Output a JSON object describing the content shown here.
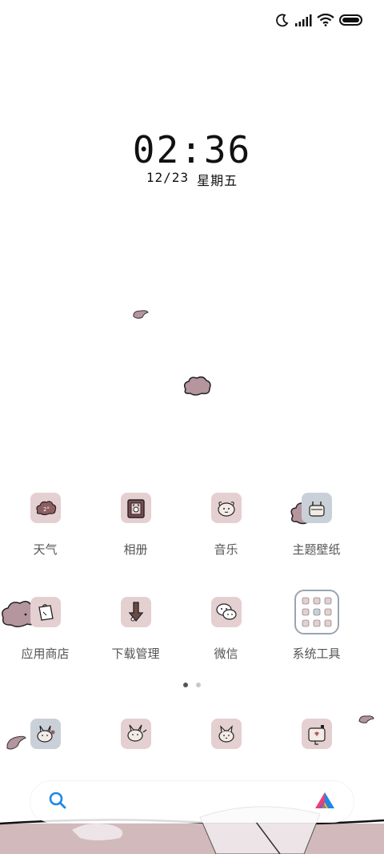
{
  "status": {
    "icons": [
      "moon-icon",
      "signal-icon",
      "wifi-icon",
      "battery-icon"
    ]
  },
  "clock": {
    "time": "02:36",
    "date": "12/23",
    "weekday": "星期五"
  },
  "apps_row1": [
    {
      "label": "天气",
      "icon": "weather-icon",
      "bg": "#e4cfd1"
    },
    {
      "label": "相册",
      "icon": "gallery-icon",
      "bg": "#e4cfd1"
    },
    {
      "label": "音乐",
      "icon": "music-icon",
      "bg": "#e4cfd1"
    },
    {
      "label": "主题壁纸",
      "icon": "themes-icon",
      "bg": "#c9d0d8"
    }
  ],
  "apps_row2": [
    {
      "label": "应用商店",
      "icon": "app-store-icon",
      "bg": "#e4cfd1"
    },
    {
      "label": "下载管理",
      "icon": "downloads-icon",
      "bg": "#e4cfd1"
    },
    {
      "label": "微信",
      "icon": "wechat-icon",
      "bg": "#e4cfd1"
    },
    {
      "label": "系统工具",
      "icon": "system-tools-folder-icon",
      "bg": "#ffffff"
    }
  ],
  "dock": [
    {
      "label": "",
      "icon": "phone-icon",
      "bg": "#c9d0d8"
    },
    {
      "label": "",
      "icon": "messages-icon",
      "bg": "#e4cfd1"
    },
    {
      "label": "",
      "icon": "browser-icon",
      "bg": "#e4cfd1"
    },
    {
      "label": "",
      "icon": "camera-icon",
      "bg": "#e4cfd1"
    }
  ],
  "pager": {
    "count": 2,
    "active": 0
  },
  "colors": {
    "accent_pink": "#e4cfd1",
    "cloud_mauve": "#b5959e",
    "search_icon": "#1e88e5"
  }
}
